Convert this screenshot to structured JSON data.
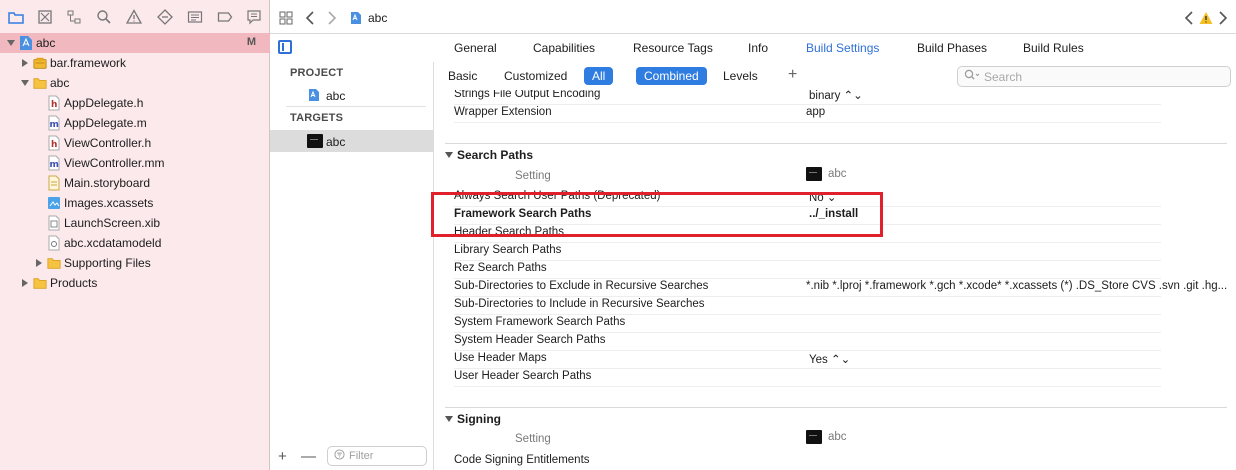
{
  "navigator": {
    "tree": [
      {
        "label": "abc",
        "badge": "M",
        "icon": "project-icon",
        "level": 0,
        "expanded": true,
        "selected": true
      },
      {
        "label": "bar.framework",
        "icon": "framework-icon",
        "level": 1,
        "collapsed": true
      },
      {
        "label": "abc",
        "icon": "folder-icon",
        "level": 1,
        "expanded": true
      },
      {
        "label": "AppDelegate.h",
        "icon": "header-file-icon",
        "level": 2
      },
      {
        "label": "AppDelegate.m",
        "icon": "source-file-icon",
        "level": 2
      },
      {
        "label": "ViewController.h",
        "icon": "header-file-icon",
        "level": 2
      },
      {
        "label": "ViewController.mm",
        "icon": "source-file-icon",
        "level": 2
      },
      {
        "label": "Main.storyboard",
        "icon": "storyboard-icon",
        "level": 2
      },
      {
        "label": "Images.xcassets",
        "icon": "assets-icon",
        "level": 2
      },
      {
        "label": "LaunchScreen.xib",
        "icon": "xib-icon",
        "level": 2
      },
      {
        "label": "abc.xcdatamodeld",
        "icon": "datamodel-icon",
        "level": 2
      },
      {
        "label": "Supporting Files",
        "icon": "folder-icon",
        "level": 2,
        "collapsed": true
      },
      {
        "label": "Products",
        "icon": "folder-icon",
        "level": 1,
        "collapsed": true
      }
    ]
  },
  "topbar": {
    "breadcrumb": "abc",
    "warning_icon": "warning-icon"
  },
  "editor_tabs": [
    "General",
    "Capabilities",
    "Resource Tags",
    "Info",
    "Build Settings",
    "Build Phases",
    "Build Rules"
  ],
  "active_editor_tab": "Build Settings",
  "target_list": {
    "project_header": "PROJECT",
    "project_item": "abc",
    "targets_header": "TARGETS",
    "target_item": "abc",
    "add_label": "+",
    "remove_label": "—",
    "filter_placeholder": "Filter"
  },
  "settings_bar": {
    "scope_tabs": [
      "Basic",
      "Customized",
      "All"
    ],
    "active_scope": "All",
    "view_tabs": [
      "Combined",
      "Levels"
    ],
    "active_view": "Combined",
    "add_label": "+",
    "search_placeholder": "Search"
  },
  "settings": {
    "top_rows": [
      {
        "name": "Strings File Output Encoding",
        "value": "binary ⌃⌄"
      },
      {
        "name": "Wrapper Extension",
        "value": "app"
      }
    ],
    "search_paths": {
      "title": "Search Paths",
      "column_setting": "Setting",
      "column_target": "abc",
      "rows": [
        {
          "name": "Always Search User Paths (Deprecated)",
          "value": "No ⌄"
        },
        {
          "name": "Framework Search Paths",
          "value": "../_install",
          "bold": true
        },
        {
          "name": "Header Search Paths",
          "value": ""
        },
        {
          "name": "Library Search Paths",
          "value": ""
        },
        {
          "name": "Rez Search Paths",
          "value": ""
        },
        {
          "name": "Sub-Directories to Exclude in Recursive Searches",
          "value": "*.nib *.lproj *.framework *.gch *.xcode* *.xcassets (*) .DS_Store CVS .svn .git .hg..."
        },
        {
          "name": "Sub-Directories to Include in Recursive Searches",
          "value": ""
        },
        {
          "name": "System Framework Search Paths",
          "value": ""
        },
        {
          "name": "System Header Search Paths",
          "value": ""
        },
        {
          "name": "Use Header Maps",
          "value": "Yes ⌃⌄"
        },
        {
          "name": "User Header Search Paths",
          "value": ""
        }
      ]
    },
    "signing": {
      "title": "Signing",
      "column_setting": "Setting",
      "column_target": "abc",
      "rows": [
        {
          "name": "Code Signing Entitlements",
          "value": ""
        }
      ]
    }
  },
  "colors": {
    "accent": "#2f7de1",
    "highlight_box": "#e0202a",
    "navigator_bg": "#fbe9ec",
    "navigator_selected": "#f1b8bf"
  }
}
